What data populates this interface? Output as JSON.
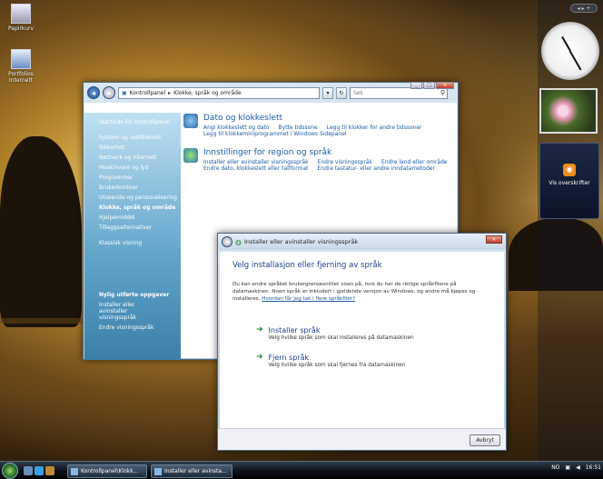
{
  "desktop": {
    "icons": [
      {
        "label": "Papirkurv"
      },
      {
        "label": "Portfolios Internett"
      }
    ],
    "sidebar_top": "◂ ▸ +"
  },
  "gadgets": {
    "rss_label": "Vis overskrifter"
  },
  "control_panel": {
    "breadcrumb": [
      "Kontrollpanel",
      "Klokke, språk og område"
    ],
    "search_placeholder": "Søk",
    "left_nav": {
      "home": "Startside for kontrollpanel",
      "items": [
        "System og vedlikehold",
        "Sikkerhet",
        "Nettverk og Internett",
        "Maskinvare og lyd",
        "Programmer",
        "Brukerkontoer",
        "Utseende og personalisering",
        "Klokke, språk og område",
        "Hjelpemiddel",
        "Tilleggsalternativer"
      ],
      "classic": "Klassisk visning",
      "recent_title": "Nylig utførte oppgaver",
      "recent": [
        "Installer eller avinstaller visningsspråk",
        "Endre visningsspråk"
      ]
    },
    "categories": [
      {
        "title": "Dato og klokkeslett",
        "links": [
          "Angi klokkeslett og dato",
          "Bytte tidssone",
          "Legg til klokker for andre tidssoner"
        ],
        "links2": [
          "Legg til klokkeminiprogrammet i Windows Sidepanel"
        ]
      },
      {
        "title": "Innstillinger for region og språk",
        "links": [
          "Installer eller avinstaller visningsspråk",
          "Endre visningsspråk",
          "Endre land eller område"
        ],
        "links2": [
          "Endre dato, klokkeslett eller tallformat",
          "Endre tastatur- eller andre inndatametoder"
        ]
      }
    ]
  },
  "dialog": {
    "title": "Installer eller avinstaller visningsspråk",
    "heading": "Velg installasjon eller fjerning av språk",
    "paragraph": "Du kan endre språket brukergrensesnittet vises på, hvis du har de riktige språkfilene på datamaskinen. Noen språk er inkludert i gjeldende versjon av Windows, og andre må kjøpes og installeres.",
    "help_link": "Hvordan får jeg tak i flere språkfiler?",
    "options": [
      {
        "title": "Installer språk",
        "desc": "Velg hvilke språk som skal installeres på datamaskinen"
      },
      {
        "title": "Fjern språk",
        "desc": "Velg hvilke språk som skal fjernes fra datamaskinen"
      }
    ],
    "cancel": "Avbryt"
  },
  "taskbar": {
    "tasks": [
      "Kontrollpanel\\Klokk...",
      "Installer eller avinsta..."
    ],
    "lang": "NO",
    "time": "16:51"
  }
}
